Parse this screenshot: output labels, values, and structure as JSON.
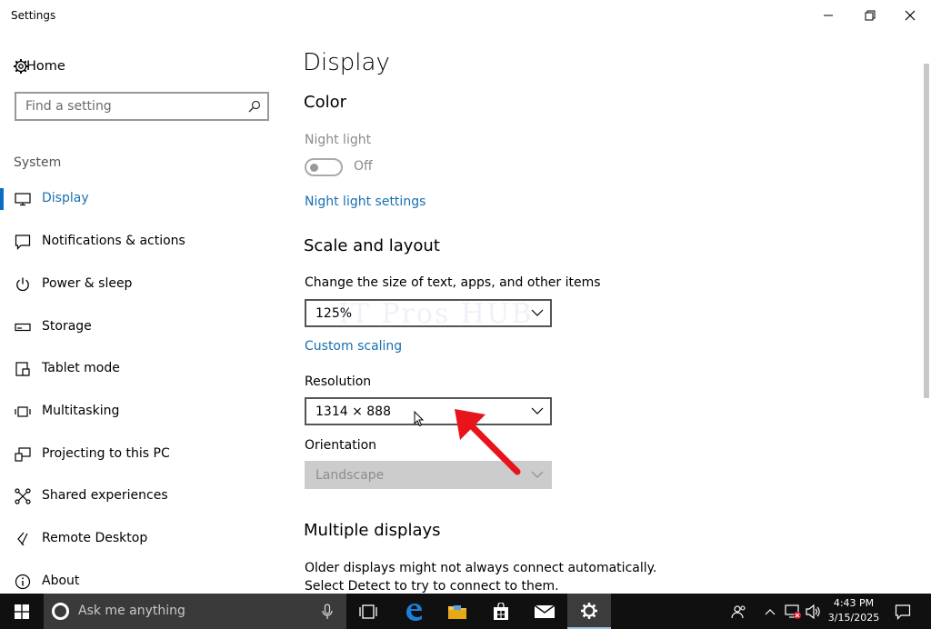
{
  "window": {
    "title": "Settings"
  },
  "sidebar": {
    "home_label": "Home",
    "search_placeholder": "Find a setting",
    "section_label": "System",
    "items": [
      {
        "label": "Display",
        "icon": "monitor-icon",
        "selected": true
      },
      {
        "label": "Notifications & actions",
        "icon": "notification-icon"
      },
      {
        "label": "Power & sleep",
        "icon": "power-icon"
      },
      {
        "label": "Storage",
        "icon": "storage-icon"
      },
      {
        "label": "Tablet mode",
        "icon": "tablet-icon"
      },
      {
        "label": "Multitasking",
        "icon": "multitasking-icon"
      },
      {
        "label": "Projecting to this PC",
        "icon": "projecting-icon"
      },
      {
        "label": "Shared experiences",
        "icon": "shared-icon"
      },
      {
        "label": "Remote Desktop",
        "icon": "remote-desktop-icon"
      },
      {
        "label": "About",
        "icon": "info-icon"
      }
    ]
  },
  "main": {
    "page_title": "Display",
    "color_heading": "Color",
    "night_light_label": "Night light",
    "night_light_state": "Off",
    "night_light_settings_link": "Night light settings",
    "scale_heading": "Scale and layout",
    "scale_label": "Change the size of text, apps, and other items",
    "scale_value": "125%",
    "custom_scaling_link": "Custom scaling",
    "resolution_label": "Resolution",
    "resolution_value": "1314 × 888",
    "orientation_label": "Orientation",
    "orientation_value": "Landscape",
    "multiple_heading": "Multiple displays",
    "multiple_text": "Older displays might not always connect automatically. Select Detect to try to connect to them."
  },
  "watermark": "IT Pros HUB",
  "taskbar": {
    "search_placeholder": "Ask me anything",
    "time": "4:43 PM",
    "date": "3/15/2025"
  },
  "colors": {
    "accent": "#0a6fc2",
    "link": "#1a6fb0",
    "taskbar": "#101010",
    "annotation_arrow": "#e8141b"
  }
}
